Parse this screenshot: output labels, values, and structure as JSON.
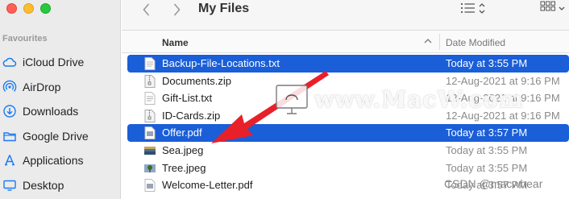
{
  "window": {
    "title": "My Files",
    "traffic_lights": {
      "close": "#ff5f57",
      "minimize": "#febc2e",
      "zoom": "#28c840"
    }
  },
  "sidebar": {
    "heading": "Favourites",
    "accent": "#1a7bf2",
    "items": [
      {
        "label": "iCloud Drive",
        "icon": "cloud-icon"
      },
      {
        "label": "AirDrop",
        "icon": "airdrop-icon"
      },
      {
        "label": "Downloads",
        "icon": "downloads-icon"
      },
      {
        "label": "Google Drive",
        "icon": "folder-icon"
      },
      {
        "label": "Applications",
        "icon": "applications-icon"
      },
      {
        "label": "Desktop",
        "icon": "desktop-icon"
      }
    ]
  },
  "toolbar": {
    "back_icon": "chevron-left-icon",
    "forward_icon": "chevron-right-icon",
    "view_icon": "list-view-icon",
    "group_icon": "grid-view-icon"
  },
  "list": {
    "columns": {
      "name": "Name",
      "date": "Date Modified"
    },
    "sort": "ascending",
    "selection_color": "#1a5ed8",
    "rows": [
      {
        "name": "Backup-File-Locations.txt",
        "date": "Today at 3:55 PM",
        "selected": true,
        "icon": "text-file-icon"
      },
      {
        "name": "Documents.zip",
        "date": "12-Aug-2021 at 9:16 PM",
        "selected": false,
        "icon": "zip-file-icon"
      },
      {
        "name": "Gift-List.txt",
        "date": "12-Aug-2021 at 9:16 PM",
        "selected": false,
        "icon": "text-file-icon"
      },
      {
        "name": "ID-Cards.zip",
        "date": "12-Aug-2021 at 9:16 PM",
        "selected": false,
        "icon": "zip-file-icon"
      },
      {
        "name": "Offer.pdf",
        "date": "Today at 3:57 PM",
        "selected": true,
        "icon": "pdf-file-icon"
      },
      {
        "name": "Sea.jpeg",
        "date": "Today at 3:55 PM",
        "selected": false,
        "icon": "image-file-icon"
      },
      {
        "name": "Tree.jpeg",
        "date": "Today at 3:55 PM",
        "selected": false,
        "icon": "image-file-icon"
      },
      {
        "name": "Welcome-Letter.pdf",
        "date": "Today at 3:57 PM",
        "selected": false,
        "icon": "pdf-file-icon"
      }
    ]
  },
  "overlay": {
    "watermark": "www.MacW.com",
    "credit": "CSDN @macwhear",
    "arrow_color": "#e8202a"
  }
}
